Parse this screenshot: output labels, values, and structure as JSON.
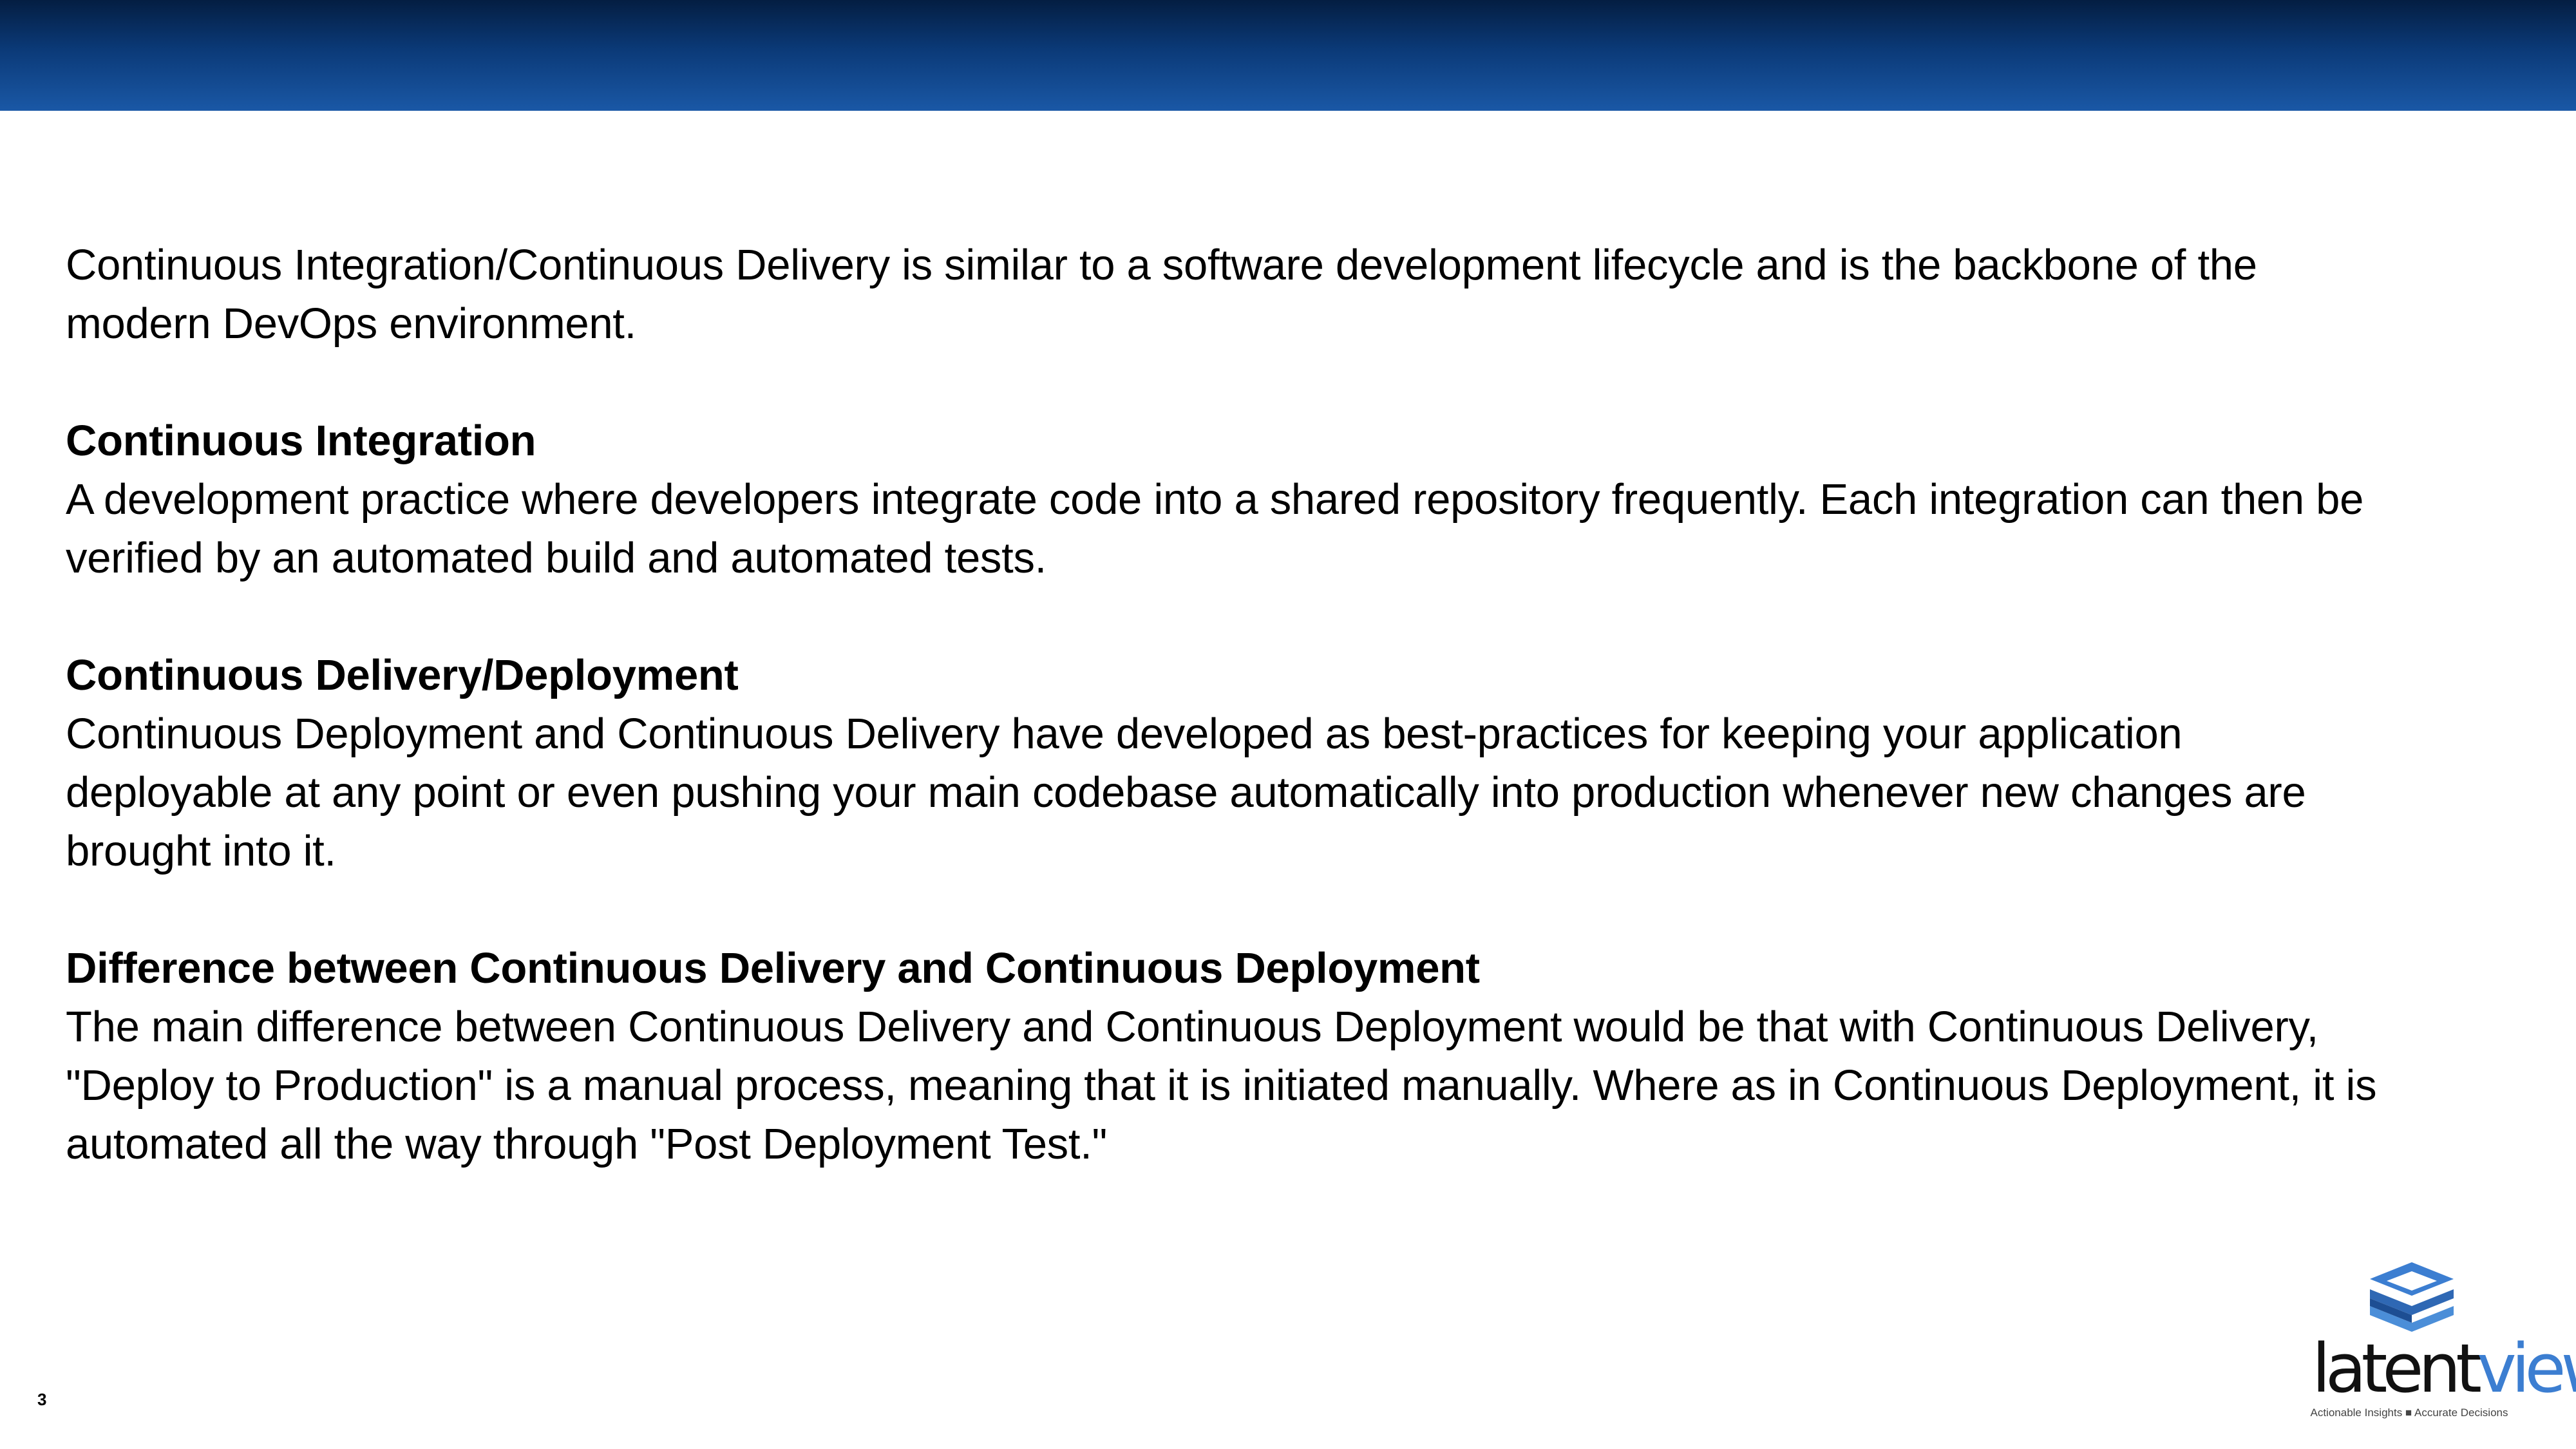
{
  "header": {
    "bar_colors": [
      "#041e42",
      "#1a58a6"
    ]
  },
  "intro": {
    "line1": "Continuous Integration/Continuous Delivery is similar to a software development lifecycle and is the backbone of the",
    "line2": "modern DevOps environment."
  },
  "section_ci": {
    "heading": "Continuous Integration",
    "line1": "A development practice where developers integrate code into a shared repository frequently. Each integration can then be",
    "line2": "verified by an automated build and automated tests."
  },
  "section_cd": {
    "heading": "Continuous Delivery/Deployment",
    "line1": "Continuous Deployment and Continuous Delivery have developed as best-practices for keeping your application",
    "line2": "deployable at any point or even pushing your main codebase automatically into production whenever new changes are",
    "line3": "brought into it."
  },
  "section_diff": {
    "heading": "Difference between Continuous Delivery and Continuous Deployment",
    "line1": "The main difference between Continuous Delivery and Continuous Deployment would be that with Continuous Delivery,",
    "line2": "\"Deploy to Production\" is a manual process, meaning that it is initiated manually. Where as in Continuous Deployment, it is",
    "line3": "automated all the way through \"Post Deployment Test.\""
  },
  "footer": {
    "page_number": "3"
  },
  "logo": {
    "word_part1": "latent",
    "word_part2": "view",
    "tagline": "Actionable Insights ■ Accurate Decisions",
    "icon": "stacked-layers-logo-icon",
    "brand_color": "#3c7ed1"
  }
}
